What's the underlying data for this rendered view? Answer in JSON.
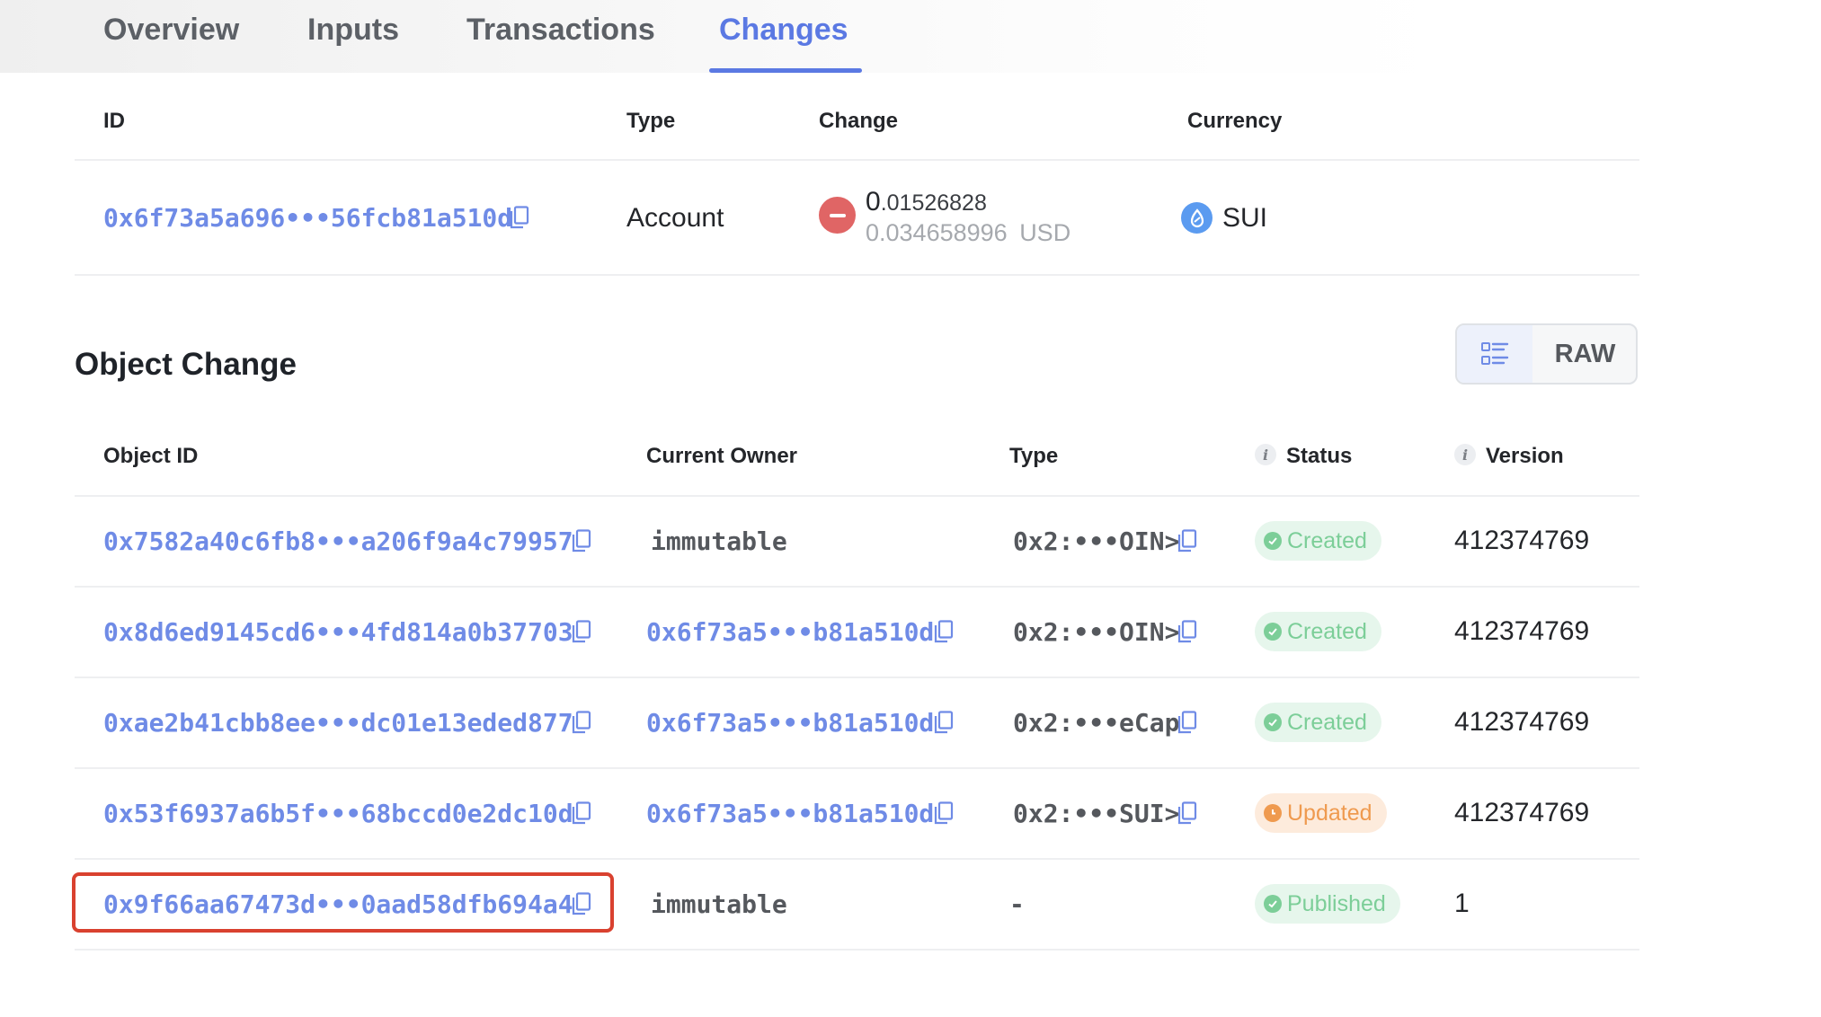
{
  "tabs": [
    {
      "label": "Overview",
      "active": false
    },
    {
      "label": "Inputs",
      "active": false
    },
    {
      "label": "Transactions",
      "active": false
    },
    {
      "label": "Changes",
      "active": true
    }
  ],
  "balance_changes": {
    "headers": {
      "id": "ID",
      "type": "Type",
      "change": "Change",
      "currency": "Currency"
    },
    "row": {
      "id": "0x6f73a5a696•••56fcb81a510d",
      "type": "Account",
      "change_int": "0",
      "change_frac": ".01526828",
      "usd_value": "0.034658996",
      "usd_unit": "USD",
      "currency": "SUI",
      "change_sign": "negative"
    }
  },
  "object_change": {
    "title": "Object Change",
    "view_toggle": {
      "list_icon": "list-view-icon",
      "raw_label": "RAW"
    },
    "headers": {
      "object_id": "Object ID",
      "owner": "Current Owner",
      "type": "Type",
      "status": "Status",
      "version": "Version"
    },
    "rows": [
      {
        "object_id": "0x7582a40c6fb8•••a206f9a4c79957",
        "owner": "immutable",
        "type": "0x2:•••OIN>",
        "status": "Created",
        "version": "412374769"
      },
      {
        "object_id": "0x8d6ed9145cd6•••4fd814a0b37703",
        "owner": "0x6f73a5•••b81a510d",
        "type": "0x2:•••OIN>",
        "status": "Created",
        "version": "412374769"
      },
      {
        "object_id": "0xae2b41cbb8ee•••dc01e13eded877",
        "owner": "0x6f73a5•••b81a510d",
        "type": "0x2:•••eCap",
        "status": "Created",
        "version": "412374769"
      },
      {
        "object_id": "0x53f6937a6b5f•••68bccd0e2dc10d",
        "owner": "0x6f73a5•••b81a510d",
        "type": "0x2:•••SUI>",
        "status": "Updated",
        "version": "412374769"
      },
      {
        "object_id": "0x9f66aa67473d•••0aad58dfb694a4",
        "owner": "immutable",
        "type": "-",
        "status": "Published",
        "version": "1"
      }
    ]
  },
  "colors": {
    "accent": "#5b79e3",
    "link": "#6f8be6",
    "created": "#7cce98",
    "updated": "#ef9a4f",
    "negative": "#e06565",
    "highlight": "#d9412f"
  }
}
